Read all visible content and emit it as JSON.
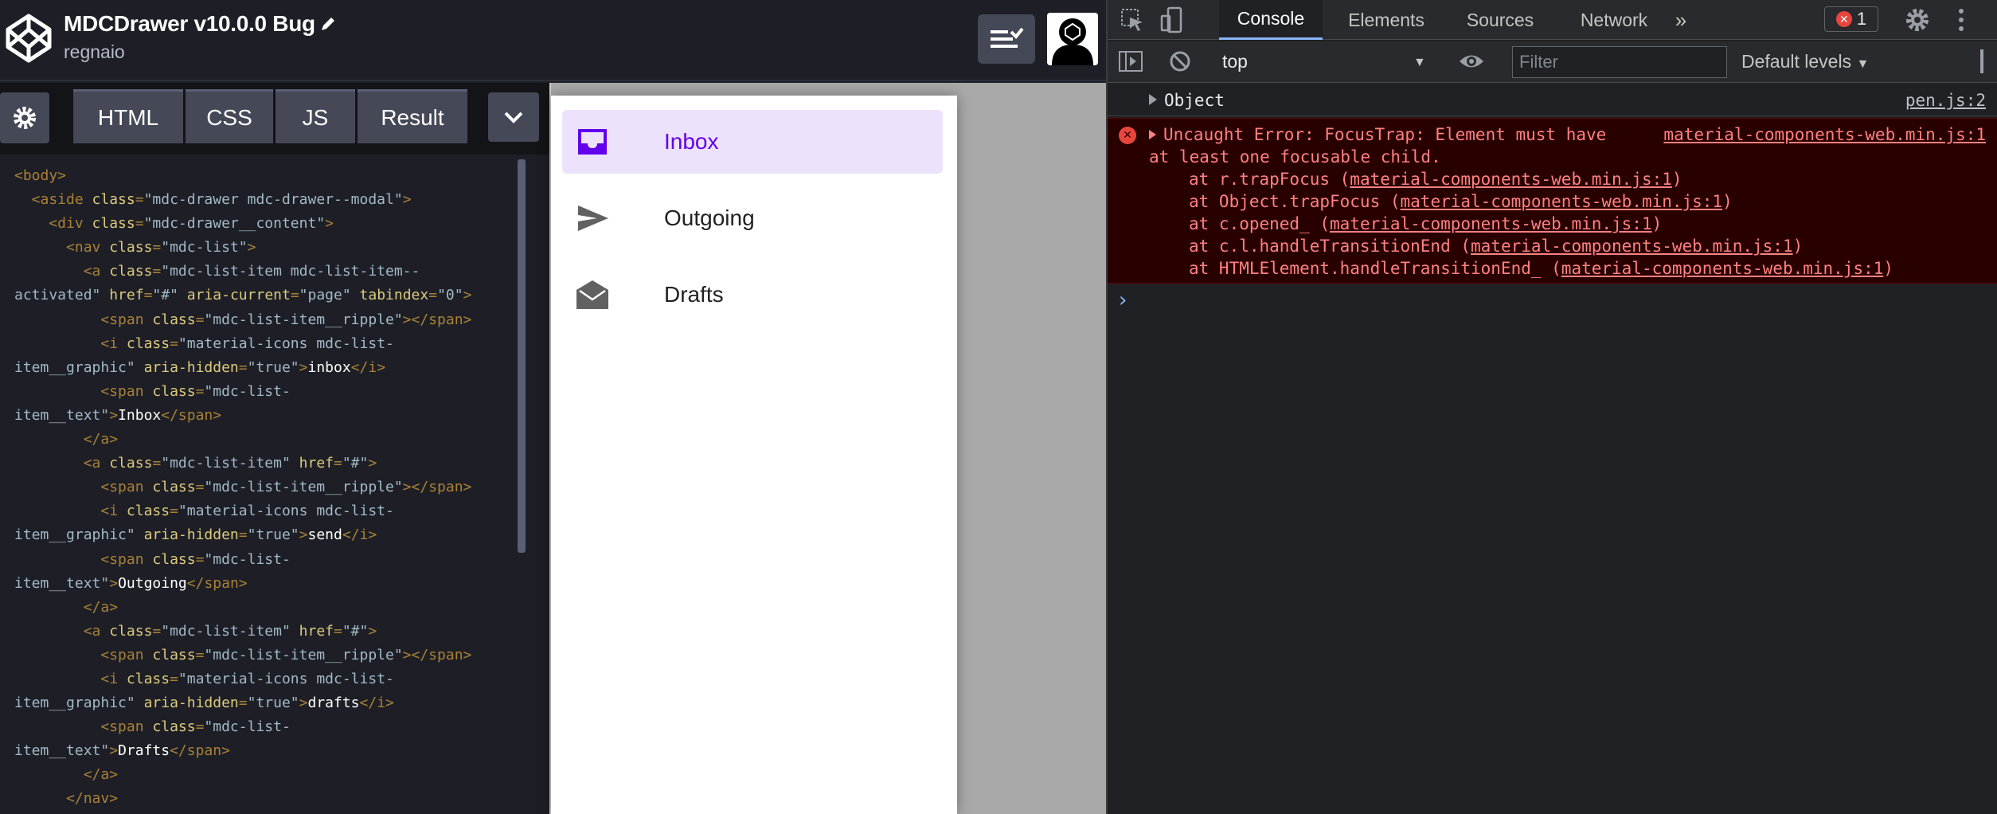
{
  "codepen": {
    "title": "MDCDrawer v10.0.0 Bug",
    "author": "regnaio",
    "tabs": [
      {
        "label": "HTML"
      },
      {
        "label": "CSS"
      },
      {
        "label": "JS"
      },
      {
        "label": "Result"
      }
    ],
    "code_lines": [
      [
        [
          "tag",
          "<body>"
        ]
      ],
      [
        [
          "tag",
          "  <aside "
        ],
        [
          "attr",
          "class"
        ],
        [
          "tag",
          "="
        ],
        [
          "val",
          "\"mdc-drawer mdc-drawer--modal\""
        ],
        [
          "tag",
          ">"
        ]
      ],
      [
        [
          "tag",
          "    <div "
        ],
        [
          "attr",
          "class"
        ],
        [
          "tag",
          "="
        ],
        [
          "val",
          "\"mdc-drawer__content\""
        ],
        [
          "tag",
          ">"
        ]
      ],
      [
        [
          "tag",
          "      <nav "
        ],
        [
          "attr",
          "class"
        ],
        [
          "tag",
          "="
        ],
        [
          "val",
          "\"mdc-list\""
        ],
        [
          "tag",
          ">"
        ]
      ],
      [
        [
          "tag",
          "        <a "
        ],
        [
          "attr",
          "class"
        ],
        [
          "tag",
          "="
        ],
        [
          "val",
          "\"mdc-list-item mdc-list-item--"
        ]
      ],
      [
        [
          "val",
          "activated\" "
        ],
        [
          "attr",
          "href"
        ],
        [
          "tag",
          "="
        ],
        [
          "val",
          "\"#\" "
        ],
        [
          "attr",
          "aria-current"
        ],
        [
          "tag",
          "="
        ],
        [
          "val",
          "\"page\" "
        ],
        [
          "attr",
          "tabindex"
        ],
        [
          "tag",
          "="
        ],
        [
          "val",
          "\"0\""
        ],
        [
          "tag",
          ">"
        ]
      ],
      [
        [
          "tag",
          "          <span "
        ],
        [
          "attr",
          "class"
        ],
        [
          "tag",
          "="
        ],
        [
          "val",
          "\"mdc-list-item__ripple\""
        ],
        [
          "tag",
          "></span>"
        ]
      ],
      [
        [
          "tag",
          "          <i "
        ],
        [
          "attr",
          "class"
        ],
        [
          "tag",
          "="
        ],
        [
          "val",
          "\"material-icons mdc-list-"
        ]
      ],
      [
        [
          "val",
          "item__graphic\" "
        ],
        [
          "attr",
          "aria-hidden"
        ],
        [
          "tag",
          "="
        ],
        [
          "val",
          "\"true\""
        ],
        [
          "tag",
          ">"
        ],
        [
          "txt",
          "inbox"
        ],
        [
          "tag",
          "</i>"
        ]
      ],
      [
        [
          "tag",
          "          <span "
        ],
        [
          "attr",
          "class"
        ],
        [
          "tag",
          "="
        ],
        [
          "val",
          "\"mdc-list-"
        ]
      ],
      [
        [
          "val",
          "item__text\""
        ],
        [
          "tag",
          ">"
        ],
        [
          "txt",
          "Inbox"
        ],
        [
          "tag",
          "</span>"
        ]
      ],
      [
        [
          "tag",
          "        </a>"
        ]
      ],
      [
        [
          "tag",
          "        <a "
        ],
        [
          "attr",
          "class"
        ],
        [
          "tag",
          "="
        ],
        [
          "val",
          "\"mdc-list-item\" "
        ],
        [
          "attr",
          "href"
        ],
        [
          "tag",
          "="
        ],
        [
          "val",
          "\"#\""
        ],
        [
          "tag",
          ">"
        ]
      ],
      [
        [
          "tag",
          "          <span "
        ],
        [
          "attr",
          "class"
        ],
        [
          "tag",
          "="
        ],
        [
          "val",
          "\"mdc-list-item__ripple\""
        ],
        [
          "tag",
          "></span>"
        ]
      ],
      [
        [
          "tag",
          "          <i "
        ],
        [
          "attr",
          "class"
        ],
        [
          "tag",
          "="
        ],
        [
          "val",
          "\"material-icons mdc-list-"
        ]
      ],
      [
        [
          "val",
          "item__graphic\" "
        ],
        [
          "attr",
          "aria-hidden"
        ],
        [
          "tag",
          "="
        ],
        [
          "val",
          "\"true\""
        ],
        [
          "tag",
          ">"
        ],
        [
          "txt",
          "send"
        ],
        [
          "tag",
          "</i>"
        ]
      ],
      [
        [
          "tag",
          "          <span "
        ],
        [
          "attr",
          "class"
        ],
        [
          "tag",
          "="
        ],
        [
          "val",
          "\"mdc-list-"
        ]
      ],
      [
        [
          "val",
          "item__text\""
        ],
        [
          "tag",
          ">"
        ],
        [
          "txt",
          "Outgoing"
        ],
        [
          "tag",
          "</span>"
        ]
      ],
      [
        [
          "tag",
          "        </a>"
        ]
      ],
      [
        [
          "tag",
          "        <a "
        ],
        [
          "attr",
          "class"
        ],
        [
          "tag",
          "="
        ],
        [
          "val",
          "\"mdc-list-item\" "
        ],
        [
          "attr",
          "href"
        ],
        [
          "tag",
          "="
        ],
        [
          "val",
          "\"#\""
        ],
        [
          "tag",
          ">"
        ]
      ],
      [
        [
          "tag",
          "          <span "
        ],
        [
          "attr",
          "class"
        ],
        [
          "tag",
          "="
        ],
        [
          "val",
          "\"mdc-list-item__ripple\""
        ],
        [
          "tag",
          "></span>"
        ]
      ],
      [
        [
          "tag",
          "          <i "
        ],
        [
          "attr",
          "class"
        ],
        [
          "tag",
          "="
        ],
        [
          "val",
          "\"material-icons mdc-list-"
        ]
      ],
      [
        [
          "val",
          "item__graphic\" "
        ],
        [
          "attr",
          "aria-hidden"
        ],
        [
          "tag",
          "="
        ],
        [
          "val",
          "\"true\""
        ],
        [
          "tag",
          ">"
        ],
        [
          "txt",
          "drafts"
        ],
        [
          "tag",
          "</i>"
        ]
      ],
      [
        [
          "tag",
          "          <span "
        ],
        [
          "attr",
          "class"
        ],
        [
          "tag",
          "="
        ],
        [
          "val",
          "\"mdc-list-"
        ]
      ],
      [
        [
          "val",
          "item__text\""
        ],
        [
          "tag",
          ">"
        ],
        [
          "txt",
          "Drafts"
        ],
        [
          "tag",
          "</span>"
        ]
      ],
      [
        [
          "tag",
          "        </a>"
        ]
      ],
      [
        [
          "tag",
          "      </nav>"
        ]
      ]
    ]
  },
  "drawer": {
    "items": [
      {
        "label": "Inbox",
        "icon": "inbox-icon",
        "active": true
      },
      {
        "label": "Outgoing",
        "icon": "send-icon",
        "active": false
      },
      {
        "label": "Drafts",
        "icon": "drafts-icon",
        "active": false
      }
    ],
    "accent_color": "#6200ee",
    "active_bg": "#ede2fb"
  },
  "devtools": {
    "tabs": [
      "Console",
      "Elements",
      "Sources",
      "Network"
    ],
    "more_tabs": "»",
    "error_count": "1",
    "context": "top",
    "filter_placeholder": "Filter",
    "levels": "Default levels",
    "console": {
      "object_row": {
        "text": "Object",
        "source": "pen.js:2"
      },
      "error": {
        "line1": "Uncaught Error: FocusTrap: Element must have",
        "line2": "at least one focusable child.",
        "source": "material-components-web.min.js:1",
        "stack": [
          {
            "at": "at r.trapFocus (",
            "link": "material-components-web.min.js:1",
            "end": ")"
          },
          {
            "at": "at Object.trapFocus (",
            "link": "material-components-web.min.js:1",
            "end": ")"
          },
          {
            "at": "at c.opened_ (",
            "link": "material-components-web.min.js:1",
            "end": ")"
          },
          {
            "at": "at c.l.handleTransitionEnd (",
            "link": "material-components-web.min.js:1",
            "end": ")"
          },
          {
            "at": "at HTMLElement.handleTransitionEnd_ (",
            "link": "material-components-web.min.js:1",
            "end": ")"
          }
        ]
      },
      "prompt": "›"
    },
    "error_color": "#ff8080",
    "error_bg": "#290000"
  }
}
